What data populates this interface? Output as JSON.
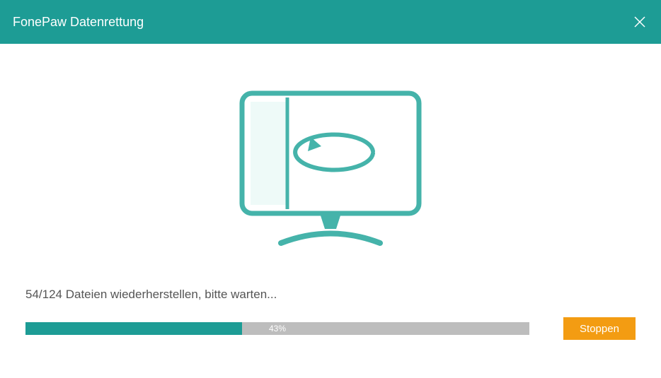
{
  "titlebar": {
    "app_title": "FonePaw Datenrettung"
  },
  "progress": {
    "status_text": "54/124 Dateien wiederherstellen, bitte warten...",
    "percent_label": "43%",
    "percent_value": 43
  },
  "buttons": {
    "stop_label": "Stoppen"
  },
  "colors": {
    "accent": "#1d9c95",
    "button": "#f39c12"
  }
}
